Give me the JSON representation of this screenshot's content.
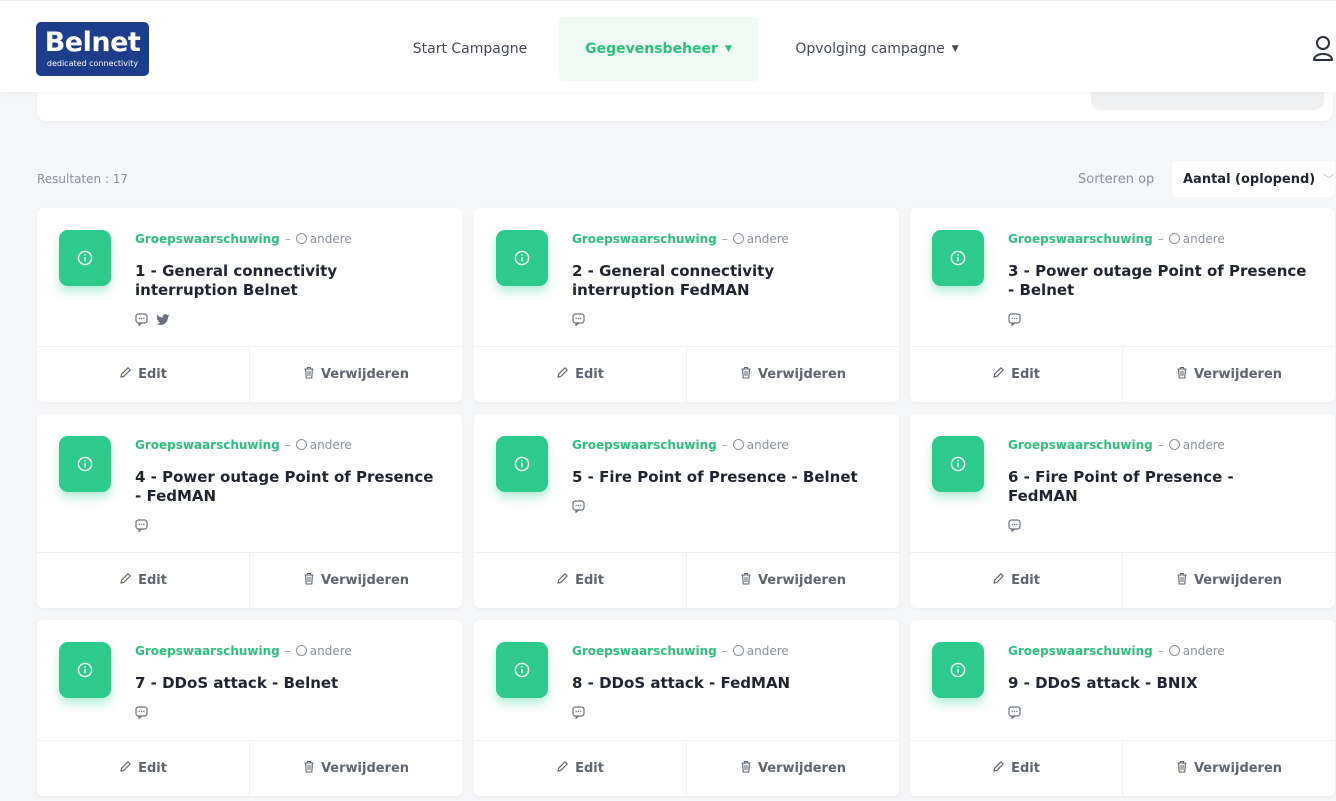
{
  "logo": {
    "word": "Belnet",
    "tagline": "dedicated connectivity"
  },
  "nav": {
    "start": "Start Campagne",
    "data": "Gegevensbeheer",
    "follow": "Opvolging campagne"
  },
  "results": {
    "label": "Resultaten : 17"
  },
  "sort": {
    "label": "Sorteren op",
    "value": "Aantal (oplopend)"
  },
  "card_common": {
    "type": "Groepswaarschuwing",
    "dash": "–",
    "other": "andere",
    "edit": "Edit",
    "delete": "Verwijderen"
  },
  "cards": [
    {
      "title": "1 - General connectivity interruption Belnet",
      "channels": [
        "chat-icon",
        "twitter-icon"
      ]
    },
    {
      "title": "2 - General connectivity interruption FedMAN",
      "channels": [
        "chat-icon"
      ]
    },
    {
      "title": "3 - Power outage Point of Presence - Belnet",
      "channels": [
        "chat-icon"
      ]
    },
    {
      "title": "4 - Power outage Point of Presence - FedMAN",
      "channels": [
        "chat-icon"
      ]
    },
    {
      "title": "5 - Fire Point of Presence - Belnet",
      "channels": [
        "chat-icon"
      ]
    },
    {
      "title": "6 - Fire Point of Presence - FedMAN",
      "channels": [
        "chat-icon"
      ]
    },
    {
      "title": "7 - DDoS attack - Belnet",
      "channels": [
        "chat-icon"
      ]
    },
    {
      "title": "8 - DDoS attack - FedMAN",
      "channels": [
        "chat-icon"
      ]
    },
    {
      "title": "9 - DDoS attack - BNIX",
      "channels": [
        "chat-icon"
      ]
    }
  ],
  "colors": {
    "accent": "#2cc07a",
    "icon_bg": "#2dca8c",
    "brand": "#1d3d8a"
  }
}
